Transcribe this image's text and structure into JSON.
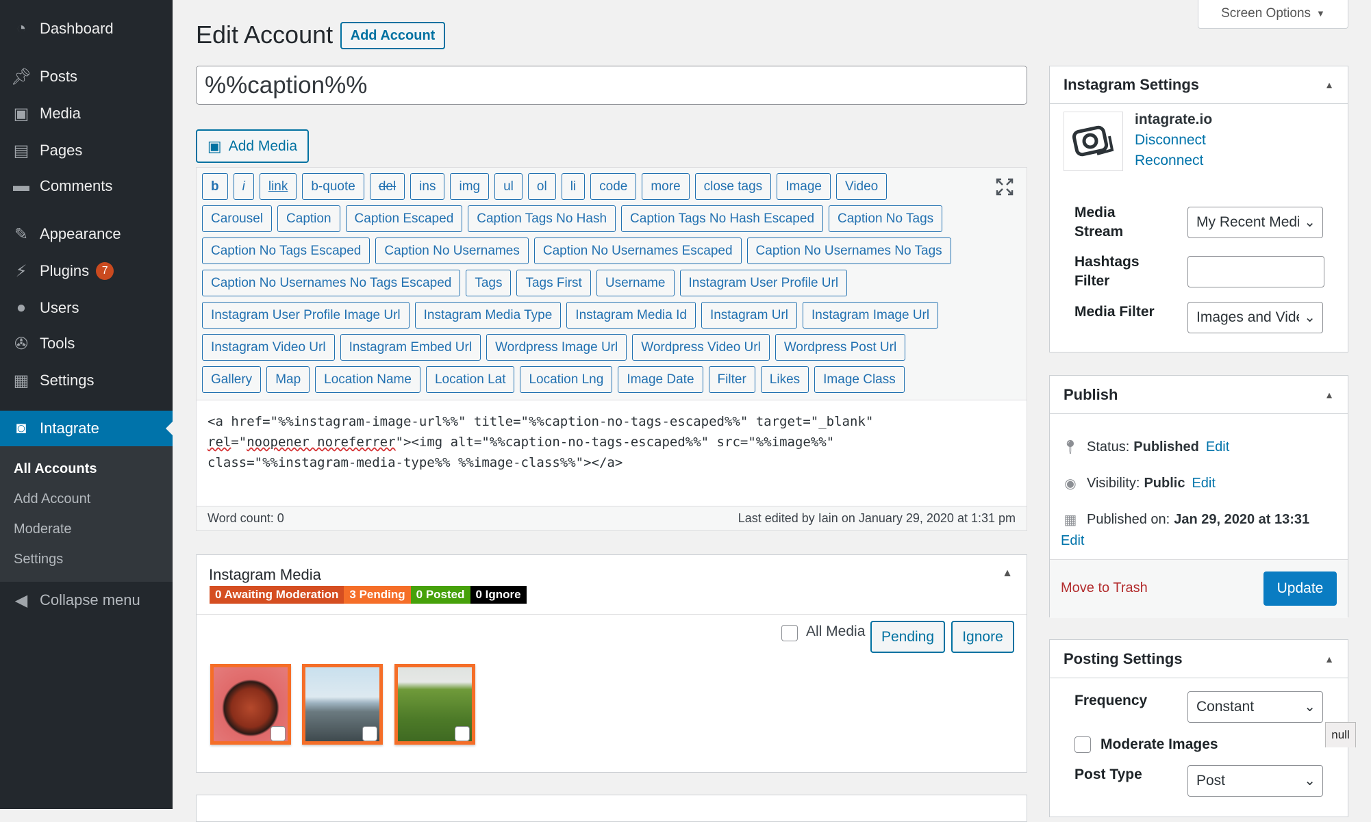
{
  "sidebar": {
    "items": [
      {
        "label": "Dashboard",
        "icon": "dashboard-icon"
      },
      {
        "label": "Posts",
        "icon": "pin-icon"
      },
      {
        "label": "Media",
        "icon": "media-icon"
      },
      {
        "label": "Pages",
        "icon": "pages-icon"
      },
      {
        "label": "Comments",
        "icon": "comment-icon"
      },
      {
        "label": "Appearance",
        "icon": "brush-icon"
      },
      {
        "label": "Plugins",
        "icon": "plug-icon",
        "badge": "7"
      },
      {
        "label": "Users",
        "icon": "user-icon"
      },
      {
        "label": "Tools",
        "icon": "wrench-icon"
      },
      {
        "label": "Settings",
        "icon": "settings-icon"
      },
      {
        "label": "Intagrate",
        "icon": "camera-icon",
        "active": true
      }
    ],
    "submenu": [
      "All Accounts",
      "Add Account",
      "Moderate",
      "Settings"
    ],
    "collapse": "Collapse menu"
  },
  "screen_options": "Screen Options",
  "header": {
    "title": "Edit Account",
    "add_button": "Add Account"
  },
  "title_input": "%%caption%%",
  "add_media": "Add Media",
  "toolbar": {
    "rows": [
      [
        "b",
        "i",
        "link",
        "b-quote",
        "del",
        "ins",
        "img",
        "ul",
        "ol",
        "li",
        "code",
        "more",
        "close tags",
        "Image",
        "Video"
      ],
      [
        "Carousel",
        "Caption",
        "Caption Escaped",
        "Caption Tags No Hash",
        "Caption Tags No Hash Escaped",
        "Caption No Tags"
      ],
      [
        "Caption No Tags Escaped",
        "Caption No Usernames",
        "Caption No Usernames Escaped",
        "Caption No Usernames No Tags"
      ],
      [
        "Caption No Usernames No Tags Escaped",
        "Tags",
        "Tags First",
        "Username",
        "Instagram User Profile Url"
      ],
      [
        "Instagram User Profile Image Url",
        "Instagram Media Type",
        "Instagram Media Id",
        "Instagram Url",
        "Instagram Image Url"
      ],
      [
        "Instagram Video Url",
        "Instagram Embed Url",
        "Wordpress Image Url",
        "Wordpress Video Url",
        "Wordpress Post Url"
      ],
      [
        "Gallery",
        "Map",
        "Location Name",
        "Location Lat",
        "Location Lng",
        "Image Date",
        "Filter",
        "Likes",
        "Image Class"
      ]
    ]
  },
  "editor": {
    "line1": "<a href=\"%%instagram-image-url%%\" title=\"%%caption-no-tags-escaped%%\" target=\"_blank\"",
    "line2a": "rel",
    "line2b": "=\"",
    "line2c": "noopener noreferrer",
    "line2d": "\"><img alt=\"%%caption-no-tags-escaped%%\" src=\"%%image%%\"",
    "line3": "class=\"%%instagram-media-type%% %%image-class%%\"></a>",
    "word_count": "Word count: 0",
    "last_edited": "Last edited by Iain on January 29, 2020 at 1:31 pm"
  },
  "instagram_media": {
    "title": "Instagram Media",
    "badges": [
      {
        "label": "0 Awaiting Moderation",
        "color": "#d54e21"
      },
      {
        "label": "3 Pending",
        "color": "#f56e28"
      },
      {
        "label": "0 Posted",
        "color": "#46a10a"
      },
      {
        "label": "0 Ignore",
        "color": "#000000"
      }
    ],
    "all_media": "All Media",
    "pending_button": "Pending",
    "ignore_button": "Ignore"
  },
  "instagram_settings": {
    "title": "Instagram Settings",
    "account": "intagrate.io",
    "disconnect": "Disconnect",
    "reconnect": "Reconnect",
    "media_stream_label": "Media Stream",
    "media_stream_value": "My Recent Media",
    "hashtags_label": "Hashtags Filter",
    "hashtags_value": "",
    "media_filter_label": "Media Filter",
    "media_filter_value": "Images and Videos"
  },
  "publish": {
    "title": "Publish",
    "status_label": "Status:",
    "status_value": "Published",
    "visibility_label": "Visibility:",
    "visibility_value": "Public",
    "published_label": "Published on:",
    "published_value": "Jan 29, 2020 at 13:31",
    "edit": "Edit",
    "trash": "Move to Trash",
    "update": "Update"
  },
  "posting_settings": {
    "title": "Posting Settings",
    "frequency_label": "Frequency",
    "frequency_value": "Constant",
    "tooltip": "null",
    "moderate_label": "Moderate Images",
    "post_type_label": "Post Type",
    "post_type_value": "Post"
  }
}
